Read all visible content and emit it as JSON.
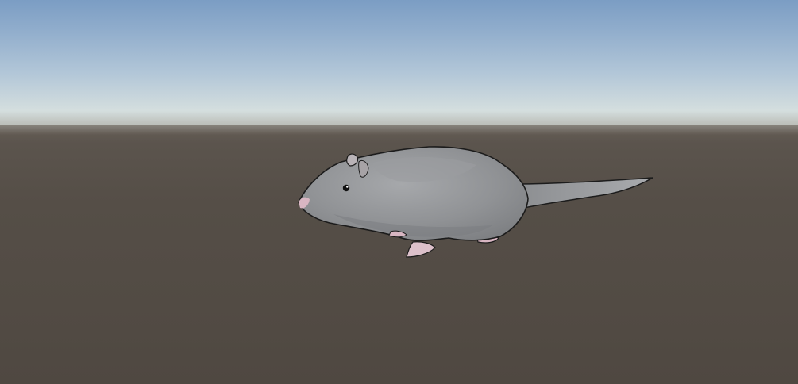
{
  "scene": {
    "subject_icon": "rat-icon",
    "colors": {
      "sky_top": "#7b9dc4",
      "sky_horizon": "#d4dede",
      "ground": "#514a43",
      "rat_fur": "#8e9093",
      "rat_fur_light": "#a5a7aa",
      "rat_pink": "#d8b6c2",
      "outline": "#1c1c1c"
    }
  }
}
